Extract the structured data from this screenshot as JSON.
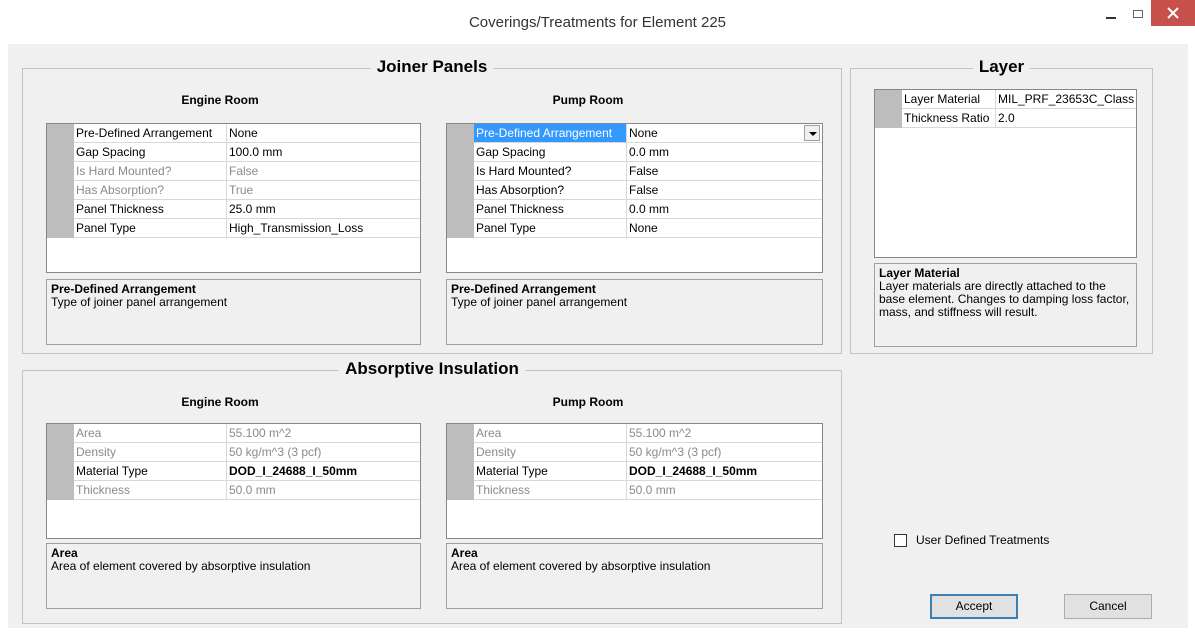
{
  "window": {
    "title": "Coverings/Treatments for Element 225"
  },
  "joiner_panels": {
    "title": "Joiner Panels",
    "engine_room": {
      "title": "Engine Room",
      "rows": [
        {
          "name": "Pre-Defined Arrangement",
          "value": "None"
        },
        {
          "name": "Gap Spacing",
          "value": "100.0 mm"
        },
        {
          "name": "Is Hard Mounted?",
          "value": "False"
        },
        {
          "name": "Has Absorption?",
          "value": "True"
        },
        {
          "name": "Panel Thickness",
          "value": "25.0 mm"
        },
        {
          "name": "Panel Type",
          "value": "High_Transmission_Loss"
        }
      ],
      "desc_title": "Pre-Defined Arrangement",
      "desc_text": "Type of joiner panel arrangement"
    },
    "pump_room": {
      "title": "Pump Room",
      "rows": [
        {
          "name": "Pre-Defined Arrangement",
          "value": "None"
        },
        {
          "name": "Gap Spacing",
          "value": "0.0 mm"
        },
        {
          "name": "Is Hard Mounted?",
          "value": "False"
        },
        {
          "name": "Has Absorption?",
          "value": "False"
        },
        {
          "name": "Panel Thickness",
          "value": "0.0 mm"
        },
        {
          "name": "Panel Type",
          "value": "None"
        }
      ],
      "desc_title": "Pre-Defined Arrangement",
      "desc_text": "Type of joiner panel arrangement"
    }
  },
  "layer": {
    "title": "Layer",
    "rows": [
      {
        "name": "Layer Material",
        "value": "MIL_PRF_23653C_Class"
      },
      {
        "name": "Thickness Ratio",
        "value": "2.0"
      }
    ],
    "desc_title": "Layer Material",
    "desc_text": "Layer materials are directly attached to the base element. Changes to damping loss factor, mass, and stiffness will result."
  },
  "absorptive_insulation": {
    "title": "Absorptive Insulation",
    "engine_room": {
      "title": "Engine Room",
      "rows": [
        {
          "name": "Area",
          "value": "55.100 m^2"
        },
        {
          "name": "Density",
          "value": "50 kg/m^3 (3 pcf)"
        },
        {
          "name": "Material Type",
          "value": "DOD_I_24688_I_50mm"
        },
        {
          "name": "Thickness",
          "value": "50.0 mm"
        }
      ],
      "desc_title": "Area",
      "desc_text": "Area of element covered by absorptive insulation"
    },
    "pump_room": {
      "title": "Pump Room",
      "rows": [
        {
          "name": "Area",
          "value": "55.100 m^2"
        },
        {
          "name": "Density",
          "value": "50 kg/m^3 (3 pcf)"
        },
        {
          "name": "Material Type",
          "value": "DOD_I_24688_I_50mm"
        },
        {
          "name": "Thickness",
          "value": "50.0 mm"
        }
      ],
      "desc_title": "Area",
      "desc_text": "Area of element covered by absorptive insulation"
    }
  },
  "options": {
    "user_defined_label": "User Defined Treatments",
    "user_defined_checked": false
  },
  "buttons": {
    "accept": "Accept",
    "cancel": "Cancel"
  },
  "colors": {
    "selection": "#3399ff",
    "close_button": "#c7504d",
    "dialog_background": "#f0f0f0",
    "grid_margin": "#bdbdbd"
  }
}
